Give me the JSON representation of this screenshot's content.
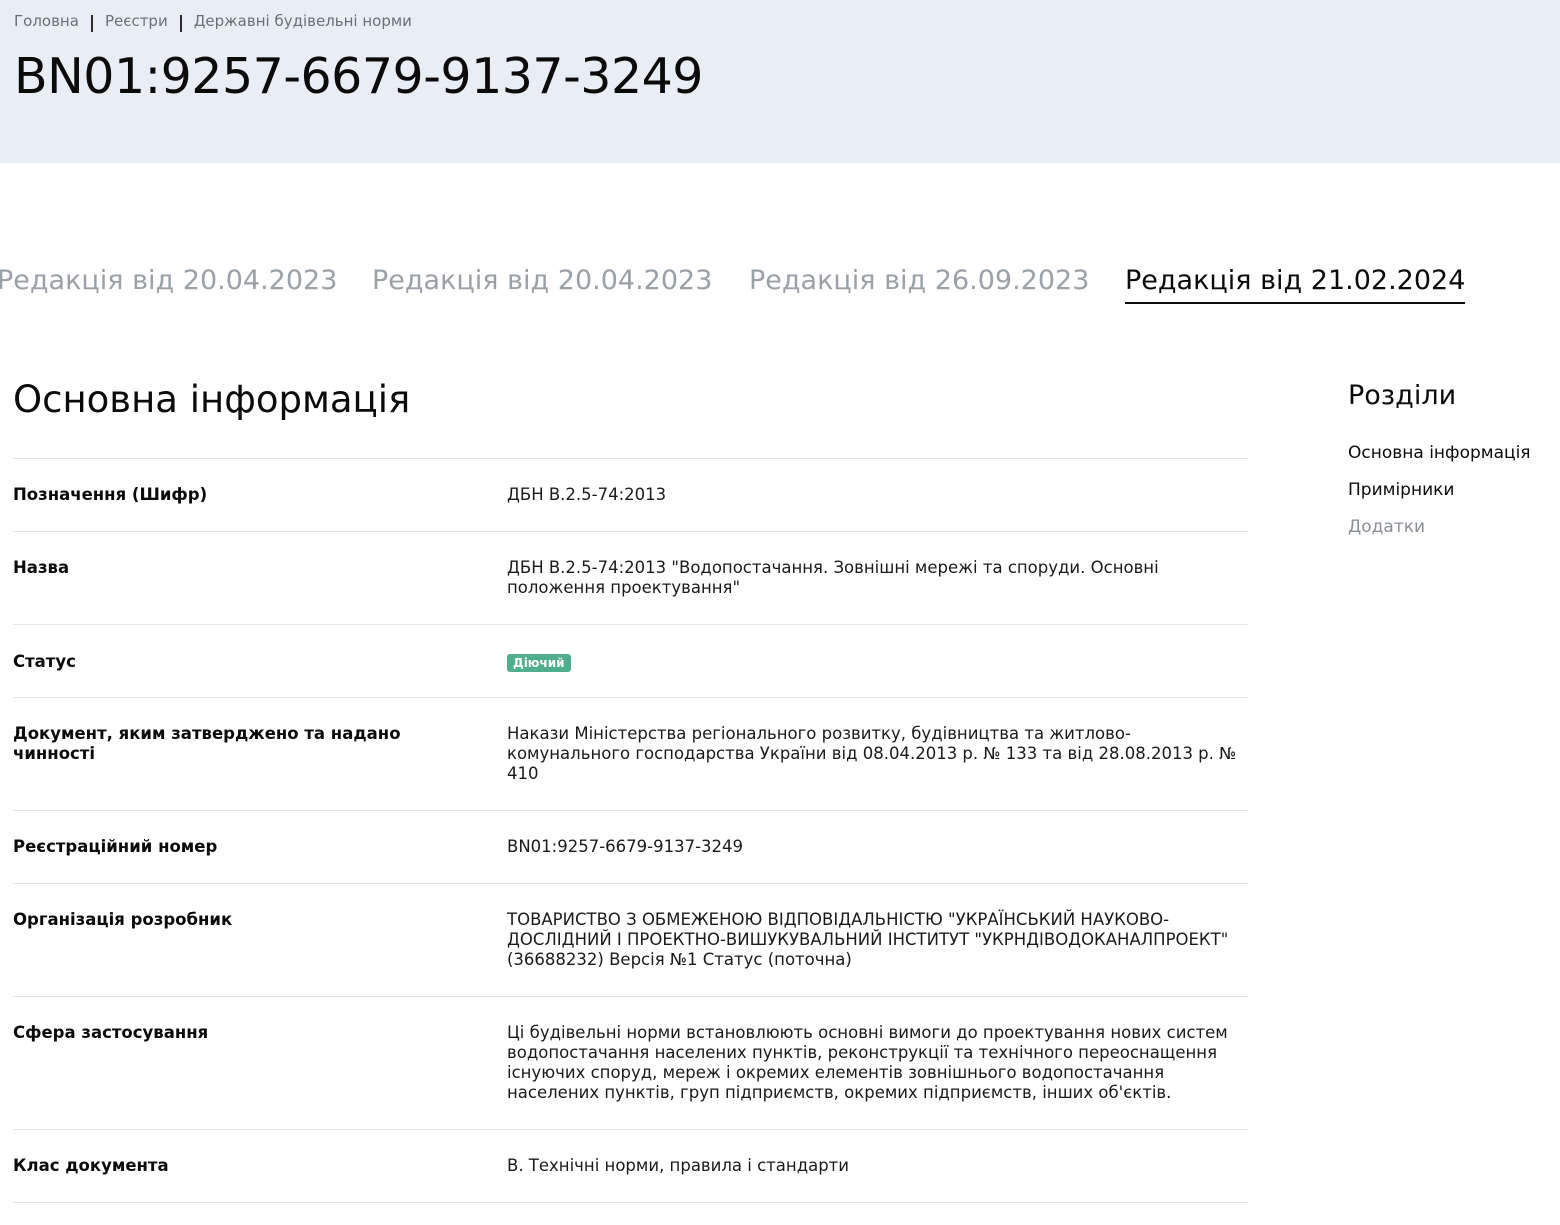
{
  "breadcrumb": {
    "items": [
      "Головна",
      "Реєстри",
      "Державні будівельні норми"
    ]
  },
  "page_title": "BN01:9257-6679-9137-3249",
  "tabs": [
    {
      "label": "Редакція від 20.04.2023",
      "active": false
    },
    {
      "label": "Редакція від 20.04.2023",
      "active": false
    },
    {
      "label": "Редакція від 26.09.2023",
      "active": false
    },
    {
      "label": "Редакція від 21.02.2024",
      "active": true
    }
  ],
  "section_title": "Основна інформація",
  "info": {
    "designation": {
      "label": "Позначення (Шифр)",
      "value": "ДБН В.2.5-74:2013"
    },
    "name": {
      "label": "Назва",
      "value": "ДБН В.2.5-74:2013 \"Водопостачання. Зовнішні мережі та споруди. Основні положення проектування\""
    },
    "status": {
      "label": "Статус",
      "value": "Діючий"
    },
    "approval_document": {
      "label": "Документ, яким затверджено та надано чинності",
      "value": "Накази Міністерства регіонального розвитку, будівництва та житлово-комунального господарства України від 08.04.2013 р. № 133 та від 28.08.2013 р. № 410"
    },
    "registration_number": {
      "label": "Реєстраційний номер",
      "value": "BN01:9257-6679-9137-3249"
    },
    "developer": {
      "label": "Організація розробник",
      "value": "ТОВАРИСТВО З ОБМЕЖЕНОЮ ВІДПОВІДАЛЬНІСТЮ \"УКРАЇНСЬКИЙ НАУКОВО-ДОСЛІДНИЙ І ПРОЕКТНО-ВИШУКУВАЛЬНИЙ ІНСТИТУТ \"УКРНДІВОДОКАНАЛПРОЕКТ\" (36688232) Версія №1 Статус (поточна)"
    },
    "scope": {
      "label": "Сфера застосування",
      "value": "Ці будівельні норми встановлюють основні вимоги до проектування нових систем водопостачання населених пунктів, реконструкції та технічного переоснащення існуючих споруд, мереж і окремих елементів зовнішнього водопостачання населених пунктів, груп підприємств, окремих підприємств, інших об'єктів."
    },
    "doc_class": {
      "label": "Клас документа",
      "value": "В. Технічні норми, правила і стандарти"
    }
  },
  "sidebar": {
    "title": "Розділи",
    "items": [
      {
        "label": "Основна інформація"
      },
      {
        "label": "Примірники"
      },
      {
        "label": "Додатки"
      }
    ]
  },
  "colors": {
    "hero_bg": "#e9edf4",
    "badge_bg": "#4fae8b",
    "inactive_tab": "#9aa0a6"
  }
}
